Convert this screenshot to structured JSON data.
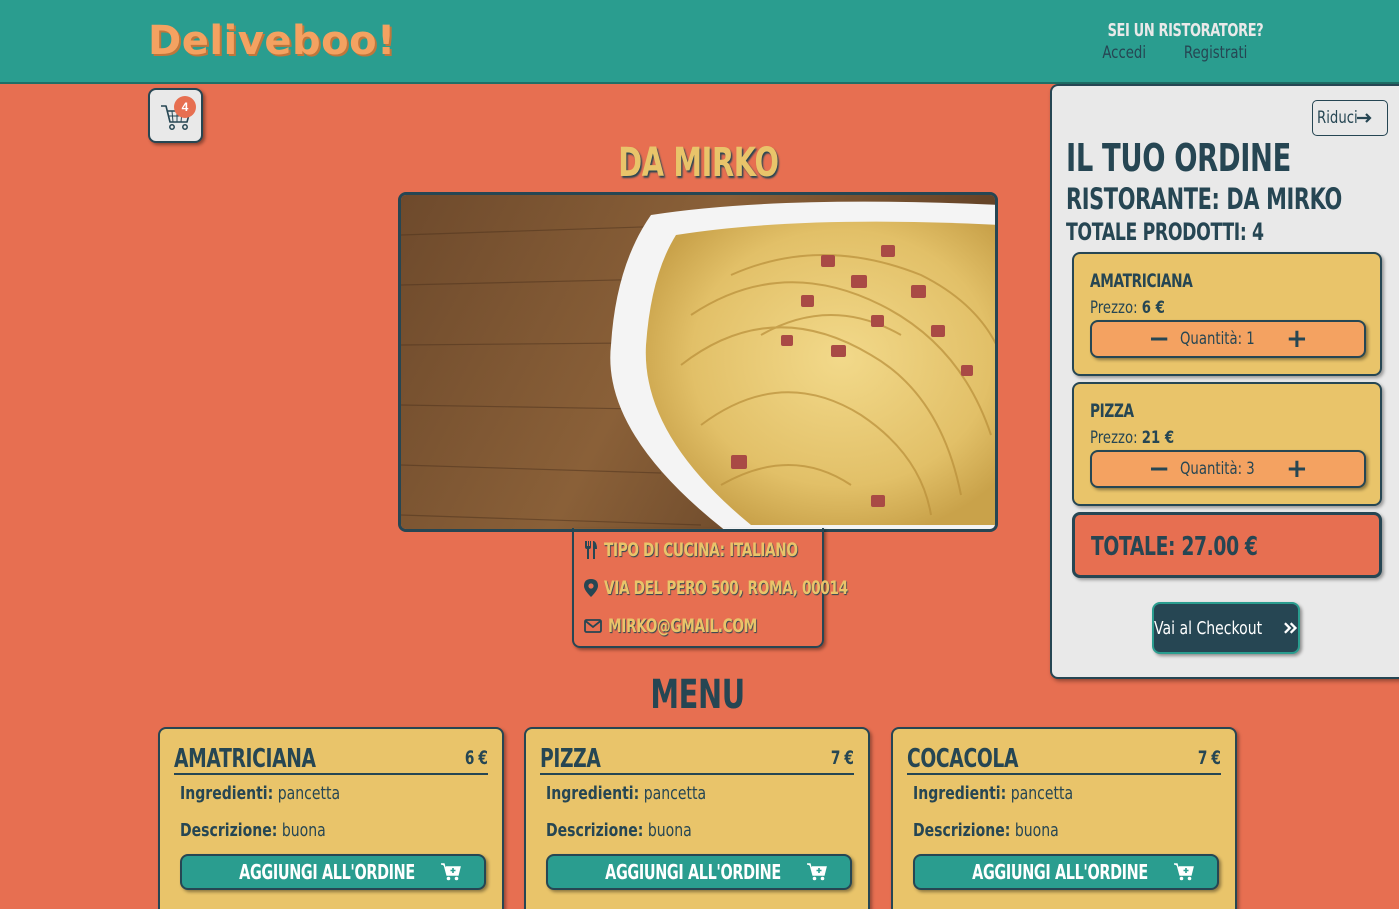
{
  "header": {
    "logo": "Deliveboo!",
    "restaurateur_question": "SEI UN RISTORATORE?",
    "login": "Accedi",
    "register": "Registrati"
  },
  "cart": {
    "icon": "cart-icon",
    "count": "4"
  },
  "restaurant": {
    "name": "DA MIRKO",
    "cuisine": "TIPO DI CUCINA: ITALIANO",
    "address": "VIA DEL PERO 500, ROMA, 00014",
    "email": "MIRKO@GMAIL.COM",
    "image_alt": "spaghetti alla carbonara"
  },
  "menu": {
    "title": "MENU",
    "items": [
      {
        "name": "AMATRICIANA",
        "price": "6 €",
        "ingredients_label": "Ingredienti:",
        "ingredients": "pancetta",
        "description_label": "Descrizione:",
        "description": "buona",
        "button": "AGGIUNGI ALL'ORDINE"
      },
      {
        "name": "PIZZA",
        "price": "7 €",
        "ingredients_label": "Ingredienti:",
        "ingredients": "pancetta",
        "description_label": "Descrizione:",
        "description": "buona",
        "button": "AGGIUNGI ALL'ORDINE"
      },
      {
        "name": "COCACOLA",
        "price": "7 €",
        "ingredients_label": "Ingredienti:",
        "ingredients": "pancetta",
        "description_label": "Descrizione:",
        "description": "buona",
        "button": "AGGIUNGI ALL'ORDINE"
      }
    ]
  },
  "order": {
    "collapse_label": "Riduci",
    "title": "IL TUO ORDINE",
    "restaurant": "RISTORANTE: DA MIRKO",
    "products_total": "TOTALE PRODOTTI: 4",
    "items": [
      {
        "name": "AMATRICIANA",
        "price_label": "Prezzo:",
        "price": "6 €",
        "quantity": "Quantità: 1"
      },
      {
        "name": "PIZZA",
        "price_label": "Prezzo:",
        "price": "21 €",
        "quantity": "Quantità: 3"
      }
    ],
    "total": "TOTALE: 27.00 €",
    "checkout": "Vai al Checkout"
  },
  "colors": {
    "background": "#e76f51",
    "header": "#2a9d8f",
    "accent_yellow": "#e9c46a",
    "accent_orange": "#f4a261",
    "dark": "#264653",
    "panel": "#e9e9e9"
  }
}
